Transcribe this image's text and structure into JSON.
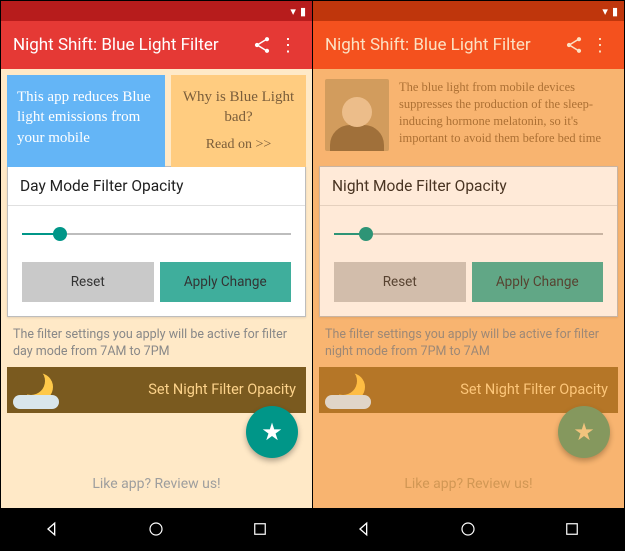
{
  "left": {
    "status_time": "",
    "app_title": "Night Shift: Blue Light Filter",
    "card_blue_text": "This app reduces Blue light emissions from your mobile",
    "card_orange_q": "Why is Blue Light bad?",
    "card_orange_readon": "Read on >>",
    "filter_header": "Day Mode Filter Opacity",
    "btn_reset": "Reset",
    "btn_apply": "Apply Change",
    "hint": "The filter settings you apply will be active for filter day mode from 7AM to 7PM",
    "night_label": "Set Night Filter Opacity",
    "review": "Like app? Review us!"
  },
  "right": {
    "app_title": "Night Shift: Blue Light Filter",
    "blurb": "The blue light from mobile devices suppresses the production of the sleep-inducing hormone melatonin, so it's important to avoid them before bed time",
    "filter_header": "Night Mode Filter Opacity",
    "btn_reset": "Reset",
    "btn_apply": "Apply Change",
    "hint": "The filter settings you apply will be active for filter night mode from 7PM to 7AM",
    "night_label": "Set Night Filter Opacity",
    "review": "Like app? Review us!"
  }
}
